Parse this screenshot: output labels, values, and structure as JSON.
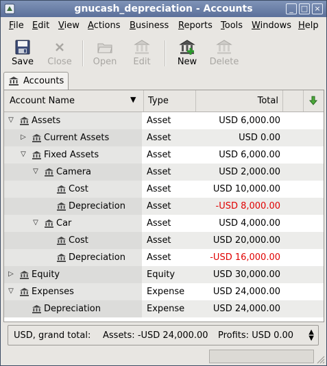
{
  "window": {
    "title": "gnucash_depreciation - Accounts"
  },
  "menu": [
    {
      "label": "File",
      "u": "F",
      "rest": "ile"
    },
    {
      "label": "Edit",
      "u": "E",
      "rest": "dit"
    },
    {
      "label": "View",
      "u": "V",
      "rest": "iew"
    },
    {
      "label": "Actions",
      "u": "A",
      "rest": "ctions"
    },
    {
      "label": "Business",
      "u": "B",
      "rest": "usiness"
    },
    {
      "label": "Reports",
      "u": "R",
      "rest": "eports"
    },
    {
      "label": "Tools",
      "u": "T",
      "rest": "ools"
    },
    {
      "label": "Windows",
      "u": "W",
      "rest": "indows"
    },
    {
      "label": "Help",
      "u": "H",
      "rest": "elp"
    }
  ],
  "toolbar": {
    "save": "Save",
    "close": "Close",
    "open": "Open",
    "edit": "Edit",
    "new": "New",
    "delete": "Delete"
  },
  "tab": {
    "label": "Accounts"
  },
  "columns": {
    "name": "Account Name",
    "type": "Type",
    "total": "Total"
  },
  "rows": [
    {
      "name": "Assets",
      "type": "Asset",
      "total": "USD 6,000.00",
      "negative": false,
      "depth": 0,
      "expander": "open"
    },
    {
      "name": "Current Assets",
      "type": "Asset",
      "total": "USD 0.00",
      "negative": false,
      "depth": 1,
      "expander": "closed"
    },
    {
      "name": "Fixed Assets",
      "type": "Asset",
      "total": "USD 6,000.00",
      "negative": false,
      "depth": 1,
      "expander": "open"
    },
    {
      "name": "Camera",
      "type": "Asset",
      "total": "USD 2,000.00",
      "negative": false,
      "depth": 2,
      "expander": "open"
    },
    {
      "name": "Cost",
      "type": "Asset",
      "total": "USD 10,000.00",
      "negative": false,
      "depth": 3,
      "expander": "none"
    },
    {
      "name": "Depreciation",
      "type": "Asset",
      "total": "-USD 8,000.00",
      "negative": true,
      "depth": 3,
      "expander": "none"
    },
    {
      "name": "Car",
      "type": "Asset",
      "total": "USD 4,000.00",
      "negative": false,
      "depth": 2,
      "expander": "open"
    },
    {
      "name": "Cost",
      "type": "Asset",
      "total": "USD 20,000.00",
      "negative": false,
      "depth": 3,
      "expander": "none"
    },
    {
      "name": "Depreciation",
      "type": "Asset",
      "total": "-USD 16,000.00",
      "negative": true,
      "depth": 3,
      "expander": "none"
    },
    {
      "name": "Equity",
      "type": "Equity",
      "total": "USD 30,000.00",
      "negative": false,
      "depth": 0,
      "expander": "closed"
    },
    {
      "name": "Expenses",
      "type": "Expense",
      "total": "USD 24,000.00",
      "negative": false,
      "depth": 0,
      "expander": "open"
    },
    {
      "name": "Depreciation",
      "type": "Expense",
      "total": "USD 24,000.00",
      "negative": false,
      "depth": 1,
      "expander": "none"
    }
  ],
  "summary": {
    "label": "USD, grand total:",
    "assets": "Assets: -USD 24,000.00",
    "profits": "Profits: USD 0.00"
  },
  "colors": {
    "negative": "#e00000",
    "titlebar": "#6d82aa"
  }
}
